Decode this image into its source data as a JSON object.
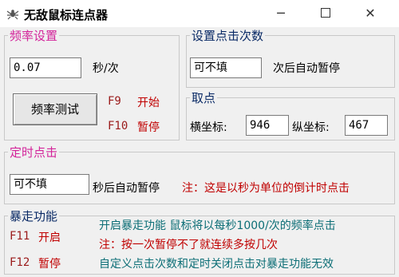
{
  "window": {
    "title": "无敌鼠标连点器",
    "icon": "spider-app-icon",
    "min_glyph": "─",
    "close_glyph": "✕"
  },
  "frequency": {
    "legend": "频率设置",
    "value": "0.07",
    "unit": "秒/次",
    "test_button": "频率测试",
    "f9_key": "F9",
    "f9_action": "开始",
    "f10_key": "F10",
    "f10_action": "暂停"
  },
  "click_count": {
    "legend": "设置点击次数",
    "value": "可不填",
    "suffix": "次后自动暂停"
  },
  "pick_point": {
    "legend": "取点",
    "x_label": "横坐标:",
    "x_value": "946",
    "y_label": "纵坐标:",
    "y_value": "467"
  },
  "timed_click": {
    "legend": "定时点击",
    "value": "可不填",
    "suffix": "秒后自动暂停",
    "note": "注：这是以秒为单位的倒计时点击"
  },
  "rapid_fire": {
    "legend": "暴走功能",
    "f11_key": "F11",
    "f11_action": "开启",
    "f12_key": "F12",
    "f12_action": "暂停",
    "line1": "开启暴走功能  鼠标将以每秒1000/次的频率点击",
    "line2": "注：按一次暂停不了就连续多按几次",
    "line3": "自定义点击次数和定时关闭点击对暴走功能无效"
  },
  "colors": {
    "legend_pink": "#d3249a",
    "note_red": "#c00000",
    "key_maroon": "#9a1a1a",
    "teal": "#0c6e76"
  }
}
